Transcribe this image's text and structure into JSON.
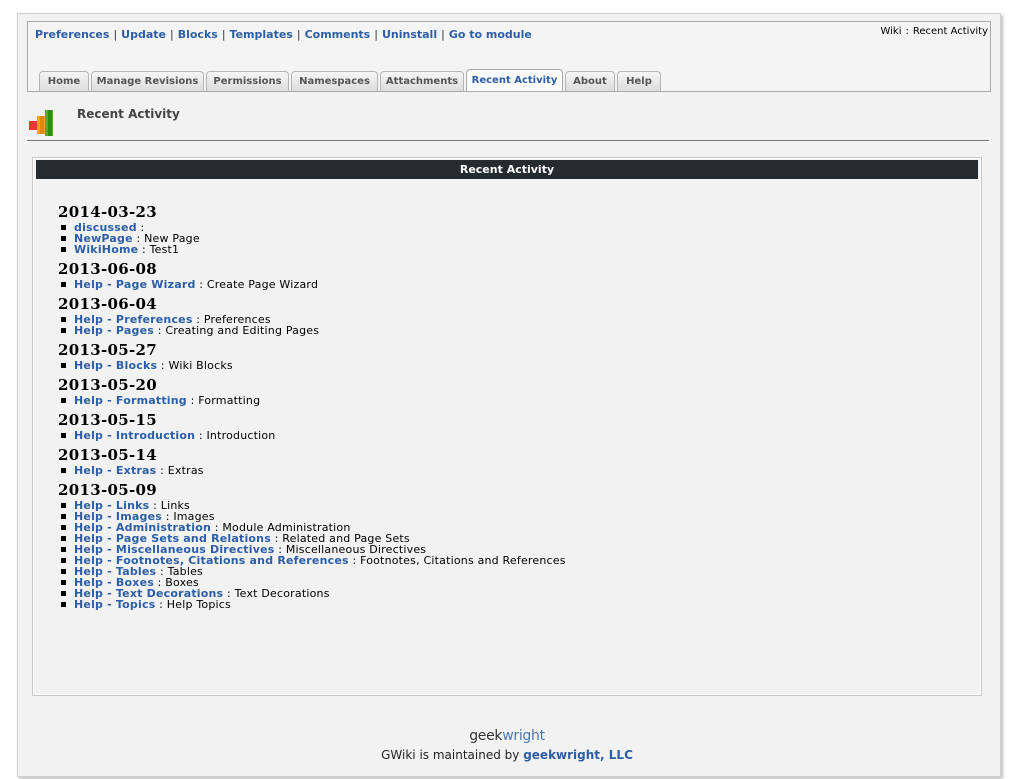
{
  "admin_links": [
    "Preferences",
    "Update",
    "Blocks",
    "Templates",
    "Comments",
    "Uninstall",
    "Go to module"
  ],
  "crumb": {
    "module": "Wiki",
    "sep": ":",
    "page": "Recent Activity"
  },
  "tabs": [
    {
      "label": "Home",
      "active": false
    },
    {
      "label": "Manage Revisions",
      "active": false
    },
    {
      "label": "Permissions",
      "active": false
    },
    {
      "label": "Namespaces",
      "active": false
    },
    {
      "label": "Attachments",
      "active": false
    },
    {
      "label": "Recent Activity",
      "active": true
    },
    {
      "label": "About",
      "active": false
    },
    {
      "label": "Help",
      "active": false
    }
  ],
  "page_title": "Recent Activity",
  "panel_title": "Recent Activity",
  "activity": [
    {
      "date": "2014-03-23",
      "items": [
        {
          "link": "discussed",
          "desc": ""
        },
        {
          "link": "NewPage",
          "desc": "New Page"
        },
        {
          "link": "WikiHome",
          "desc": "Test1"
        }
      ]
    },
    {
      "date": "2013-06-08",
      "items": [
        {
          "link": "Help - Page Wizard",
          "desc": "Create Page Wizard"
        }
      ]
    },
    {
      "date": "2013-06-04",
      "items": [
        {
          "link": "Help - Preferences",
          "desc": "Preferences"
        },
        {
          "link": "Help - Pages",
          "desc": "Creating and Editing Pages"
        }
      ]
    },
    {
      "date": "2013-05-27",
      "items": [
        {
          "link": "Help - Blocks",
          "desc": "Wiki Blocks"
        }
      ]
    },
    {
      "date": "2013-05-20",
      "items": [
        {
          "link": "Help - Formatting",
          "desc": "Formatting"
        }
      ]
    },
    {
      "date": "2013-05-15",
      "items": [
        {
          "link": "Help - Introduction",
          "desc": "Introduction"
        }
      ]
    },
    {
      "date": "2013-05-14",
      "items": [
        {
          "link": "Help - Extras",
          "desc": "Extras"
        }
      ]
    },
    {
      "date": "2013-05-09",
      "items": [
        {
          "link": "Help - Links",
          "desc": "Links"
        },
        {
          "link": "Help - Images",
          "desc": "Images"
        },
        {
          "link": "Help - Administration",
          "desc": "Module Administration"
        },
        {
          "link": "Help - Page Sets and Relations",
          "desc": "Related and Page Sets"
        },
        {
          "link": "Help - Miscellaneous Directives",
          "desc": "Miscellaneous Directives"
        },
        {
          "link": "Help - Footnotes, Citations and References",
          "desc": "Footnotes, Citations and References"
        },
        {
          "link": "Help - Tables",
          "desc": "Tables"
        },
        {
          "link": "Help - Boxes",
          "desc": "Boxes"
        },
        {
          "link": "Help - Text Decorations",
          "desc": "Text Decorations"
        },
        {
          "link": "Help - Topics",
          "desc": "Help Topics"
        }
      ]
    }
  ],
  "footer": {
    "logo_part1": "geek",
    "logo_part2": "wright",
    "maintained_prefix": "GWiki is maintained by",
    "maintained_link": "geekwright, LLC"
  },
  "colors": {
    "link": "#2b5ea6",
    "panel_header": "#262b30",
    "page_bg": "#f2f2f2"
  },
  "icons": {
    "page_icon": "bar-chart-icon"
  }
}
